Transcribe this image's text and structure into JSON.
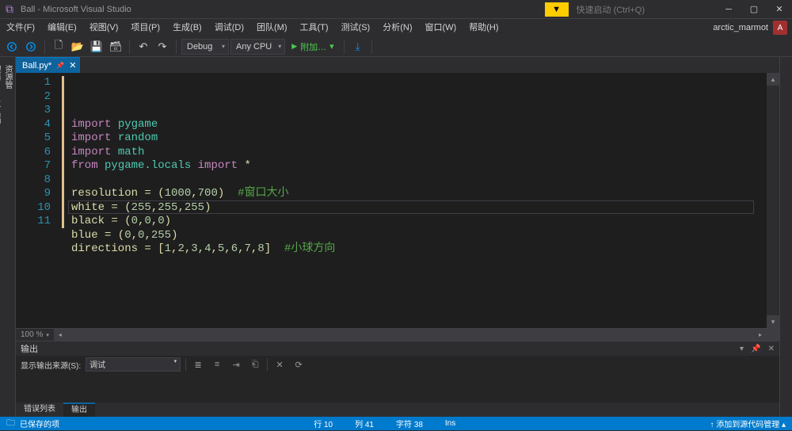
{
  "titlebar": {
    "title": "Ball - Microsoft Visual Studio",
    "notif_icon": "▼",
    "quick_launch": "快速启动 (Ctrl+Q)"
  },
  "account": {
    "name": "arctic_marmot",
    "initial": "A"
  },
  "menu": {
    "items": [
      "文件(F)",
      "编辑(E)",
      "视图(V)",
      "项目(P)",
      "生成(B)",
      "调试(D)",
      "团队(M)",
      "工具(T)",
      "测试(S)",
      "分析(N)",
      "窗口(W)",
      "帮助(H)"
    ]
  },
  "toolbar": {
    "config": "Debug",
    "platform": "Any CPU",
    "run": "附加…"
  },
  "left_tabs": [
    "服务器资源管理器",
    "工具箱"
  ],
  "doctab": {
    "name": "Ball.py*",
    "modified": true
  },
  "editor": {
    "zoom": "100 %",
    "lines": [
      {
        "n": 1,
        "tokens": [
          [
            "kw1",
            "import"
          ],
          [
            "sp",
            " "
          ],
          [
            "mod",
            "pygame"
          ]
        ]
      },
      {
        "n": 2,
        "tokens": [
          [
            "kw1",
            "import"
          ],
          [
            "sp",
            " "
          ],
          [
            "mod",
            "random"
          ]
        ]
      },
      {
        "n": 3,
        "tokens": [
          [
            "kw1",
            "import"
          ],
          [
            "sp",
            " "
          ],
          [
            "mod",
            "math"
          ]
        ]
      },
      {
        "n": 4,
        "tokens": [
          [
            "kw1",
            "from"
          ],
          [
            "sp",
            " "
          ],
          [
            "mod",
            "pygame.locals"
          ],
          [
            "sp",
            " "
          ],
          [
            "kw1",
            "import"
          ],
          [
            "sp",
            " "
          ],
          [
            "star",
            "*"
          ]
        ]
      },
      {
        "n": 5,
        "tokens": []
      },
      {
        "n": 6,
        "tokens": [
          [
            "var",
            "resolution = ("
          ],
          [
            "num",
            "1000"
          ],
          [
            "var",
            ","
          ],
          [
            "num",
            "700"
          ],
          [
            "var",
            ")  "
          ],
          [
            "cmt",
            "#窗口大小"
          ]
        ]
      },
      {
        "n": 7,
        "tokens": [
          [
            "var",
            "white = ("
          ],
          [
            "num",
            "255"
          ],
          [
            "var",
            ","
          ],
          [
            "num",
            "255"
          ],
          [
            "var",
            ","
          ],
          [
            "num",
            "255"
          ],
          [
            "var",
            ")"
          ]
        ]
      },
      {
        "n": 8,
        "tokens": [
          [
            "var",
            "black = ("
          ],
          [
            "num",
            "0"
          ],
          [
            "var",
            ","
          ],
          [
            "num",
            "0"
          ],
          [
            "var",
            ","
          ],
          [
            "num",
            "0"
          ],
          [
            "var",
            ")"
          ]
        ]
      },
      {
        "n": 9,
        "tokens": [
          [
            "var",
            "blue = ("
          ],
          [
            "num",
            "0"
          ],
          [
            "var",
            ","
          ],
          [
            "num",
            "0"
          ],
          [
            "var",
            ","
          ],
          [
            "num",
            "255"
          ],
          [
            "var",
            ")"
          ]
        ]
      },
      {
        "n": 10,
        "tokens": [
          [
            "var",
            "directions = ["
          ],
          [
            "num",
            "1"
          ],
          [
            "var",
            ","
          ],
          [
            "num",
            "2"
          ],
          [
            "var",
            ","
          ],
          [
            "num",
            "3"
          ],
          [
            "var",
            ","
          ],
          [
            "num",
            "4"
          ],
          [
            "var",
            ","
          ],
          [
            "num",
            "5"
          ],
          [
            "var",
            ","
          ],
          [
            "num",
            "6"
          ],
          [
            "var",
            ","
          ],
          [
            "num",
            "7"
          ],
          [
            "var",
            ","
          ],
          [
            "num",
            "8"
          ],
          [
            "var",
            "]  "
          ],
          [
            "cmt",
            "#小球方向"
          ]
        ]
      },
      {
        "n": 11,
        "tokens": []
      }
    ],
    "highlight_line_index": 9
  },
  "output": {
    "title": "输出",
    "source_label": "显示输出来源(S):",
    "source_value": "调试",
    "tabs": [
      "错误列表",
      "输出"
    ],
    "active_tab": 1
  },
  "status": {
    "saved": "已保存的项",
    "line": "行 10",
    "col": "列 41",
    "char": "字符 38",
    "ins": "Ins",
    "add_src": "↑ 添加到源代码管理 ▴"
  }
}
